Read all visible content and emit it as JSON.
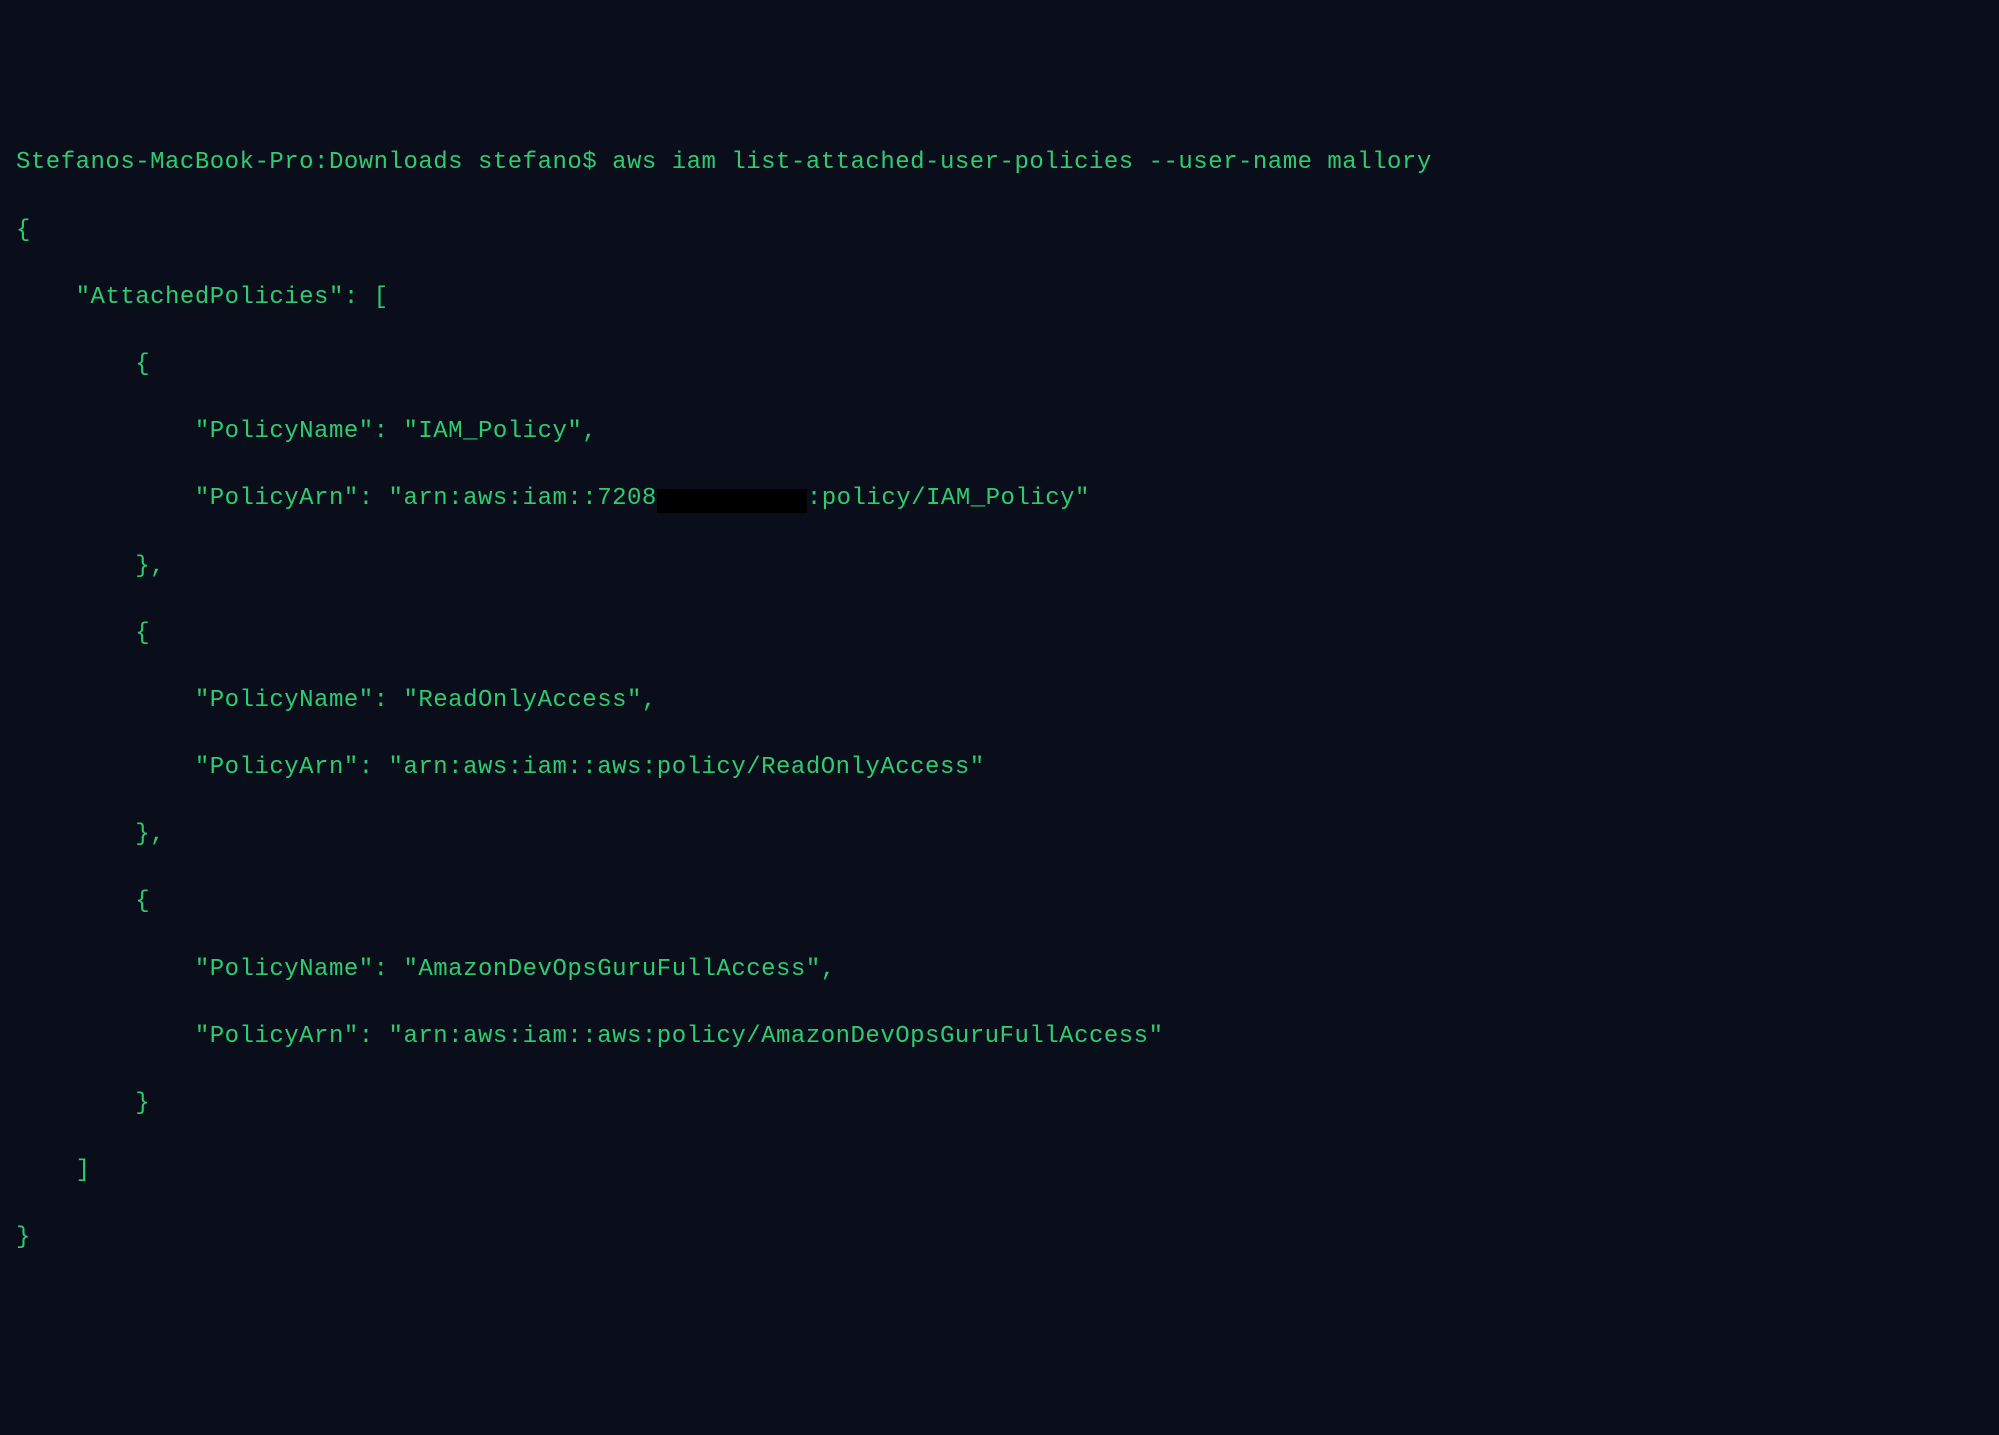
{
  "prompt": {
    "host_path": "Stefanos-MacBook-Pro:Downloads stefano$ ",
    "command": "aws iam list-attached-user-policies --user-name mallory"
  },
  "output": {
    "open_brace": "{",
    "key_attached_policies": "    \"AttachedPolicies\": [",
    "item_open": "        {",
    "item_close_comma": "        },",
    "item_close": "        }",
    "array_close": "    ]",
    "close_brace": "}",
    "policy1": {
      "name_line": "            \"PolicyName\": \"IAM_Policy\",",
      "arn_prefix": "            \"PolicyArn\": \"arn:aws:iam::7208",
      "arn_suffix": ":policy/IAM_Policy\""
    },
    "policy2": {
      "name_line": "            \"PolicyName\": \"ReadOnlyAccess\",",
      "arn_line": "            \"PolicyArn\": \"arn:aws:iam::aws:policy/ReadOnlyAccess\""
    },
    "policy3": {
      "name_line": "            \"PolicyName\": \"AmazonDevOpsGuruFullAccess\",",
      "arn_line": "            \"PolicyArn\": \"arn:aws:iam::aws:policy/AmazonDevOpsGuruFullAccess\""
    }
  }
}
